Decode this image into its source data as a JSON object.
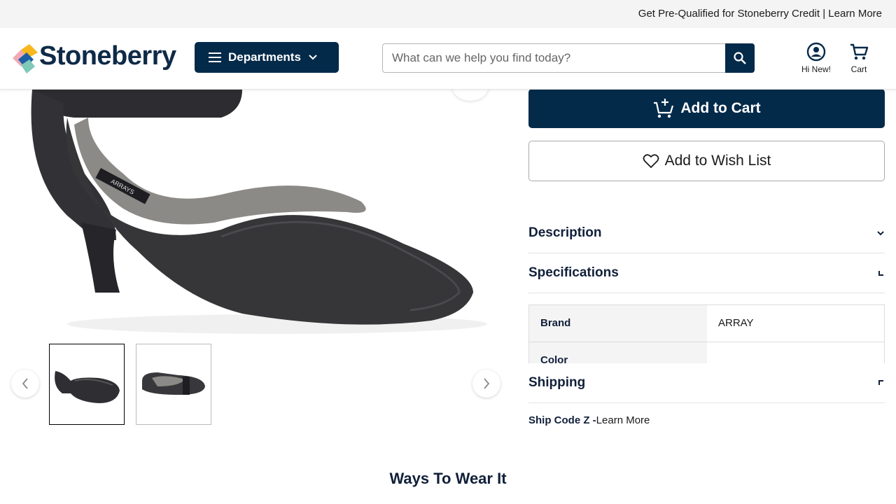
{
  "topbar": {
    "promo": "Get Pre-Qualified for Stoneberry Credit | Learn More"
  },
  "header": {
    "logo_text": "Stoneberry",
    "departments_label": "Departments",
    "search_placeholder": "What can we help you find today?",
    "account_label": "Hi New!",
    "cart_label": "Cart"
  },
  "gallery": {
    "thumbnails": [
      "Side view",
      "Top view"
    ],
    "active_index": 0,
    "product_brand_on_insole": "ARRAYS"
  },
  "actions": {
    "add_to_cart": "Add to Cart",
    "add_to_wishlist": "Add to Wish List"
  },
  "details": {
    "description_title": "Description",
    "specifications_title": "Specifications",
    "specs": [
      {
        "key": "Brand",
        "value": "ARRAY"
      },
      {
        "key": "Color",
        "value": ""
      }
    ],
    "shipping_title": "Shipping",
    "ship_code": "Ship Code Z -",
    "ship_link": "Learn More"
  },
  "section": {
    "ways_to_wear": "Ways To Wear It"
  },
  "colors": {
    "navy": "#042a4a",
    "text": "#11203a"
  }
}
